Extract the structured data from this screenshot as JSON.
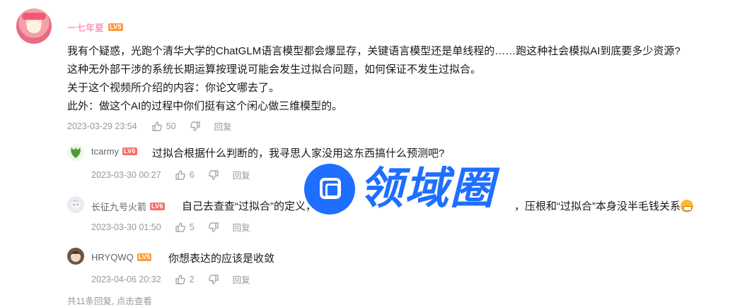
{
  "main_comment": {
    "username": "一七年夏",
    "level": "LV5",
    "lines": [
      "我有个疑惑，光跑个清华大学的ChatGLM语言模型都会爆显存，关键语言模型还是单线程的……跑这种社会模拟AI到底要多少资源?",
      "这种无外部干涉的系统长期运算按理说可能会发生过拟合问题，如何保证不发生过拟合。",
      "关于这个视频所介绍的内容：你论文哪去了。",
      "此外：做这个AI的过程中你们挺有这个闲心做三维模型的。"
    ],
    "time": "2023-03-29 23:54",
    "likes": "50",
    "reply_label": "回复"
  },
  "replies": [
    {
      "username": "tcarmy",
      "level": "LV6",
      "text": "过拟合根据什么判断的，我寻思人家没用这东西搞什么预测吧?",
      "time": "2023-03-30 00:27",
      "likes": "6",
      "reply_label": "回复"
    },
    {
      "username": "长征九号火箭",
      "level": "LV6",
      "text_a": "自己去查查“过拟合”的定义，",
      "text_b": "，压根和“过拟合”本身没半毛钱关系",
      "time": "2023-03-30 01:50",
      "likes": "5",
      "reply_label": "回复"
    },
    {
      "username": "HRYQWQ",
      "level": "LV5",
      "text": "你想表达的应该是收敛",
      "time": "2023-04-06 20:32",
      "likes": "2",
      "reply_label": "回复"
    }
  ],
  "view_more": "共11条回复, 点击查看",
  "watermark": {
    "text": "领域圈",
    "color": "#1e6fff"
  },
  "colors": {
    "username_main": "#fb7299",
    "meta": "#9499a0",
    "lv5": "#ff9a3c",
    "lv6": "#f66d6d"
  }
}
